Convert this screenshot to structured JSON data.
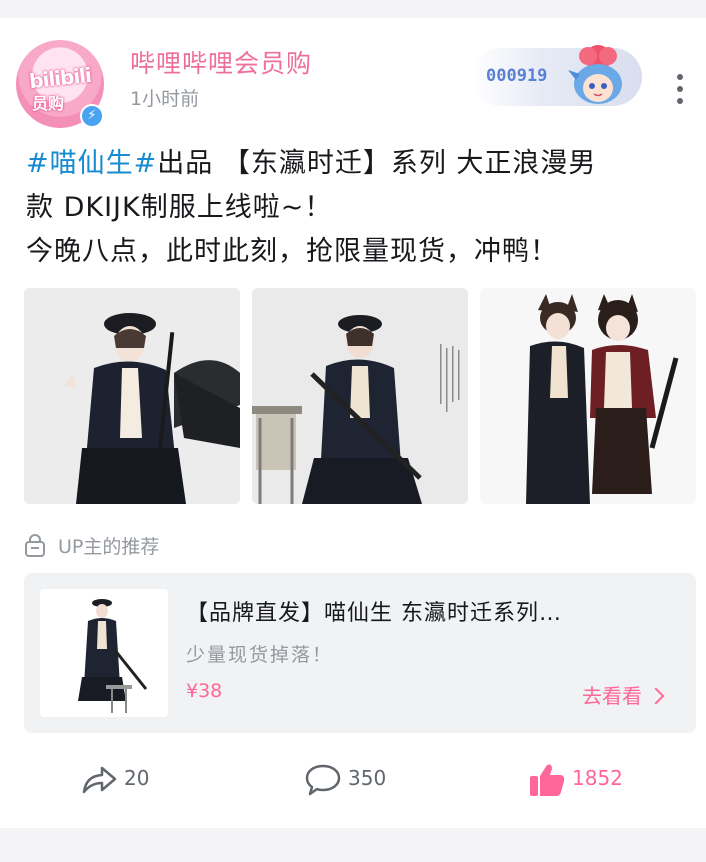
{
  "user": {
    "name": "哔哩哔哩会员购",
    "time": "1小时前",
    "avatar_text": "bilibili",
    "avatar_text2": "员购",
    "badge_number": "000919"
  },
  "post": {
    "tag": "#喵仙生#",
    "line1_rest": "出品 【东瀛时迁】系列 大正浪漫男",
    "line2": "款 DKIJK制服上线啦~！",
    "line3": "今晚八点，此时此刻，抢限量现货，冲鸭！"
  },
  "recommend": {
    "label": "UP主的推荐"
  },
  "goods": {
    "title": "【品牌直发】喵仙生 东瀛时迁系列…",
    "subtitle": "少量现货掉落！",
    "price": "¥38",
    "action": "去看看"
  },
  "actions": {
    "share_count": "20",
    "comment_count": "350",
    "like_count": "1852"
  },
  "colors": {
    "accent": "#ff6699",
    "username": "#ef6f9c",
    "topic": "#178bcf",
    "muted": "#9499a0"
  },
  "icons": {
    "share": "share-arrow-icon",
    "comment": "comment-bubble-icon",
    "like": "thumbs-up-icon",
    "more": "more-vertical-icon",
    "bag": "shopping-bag-icon"
  }
}
